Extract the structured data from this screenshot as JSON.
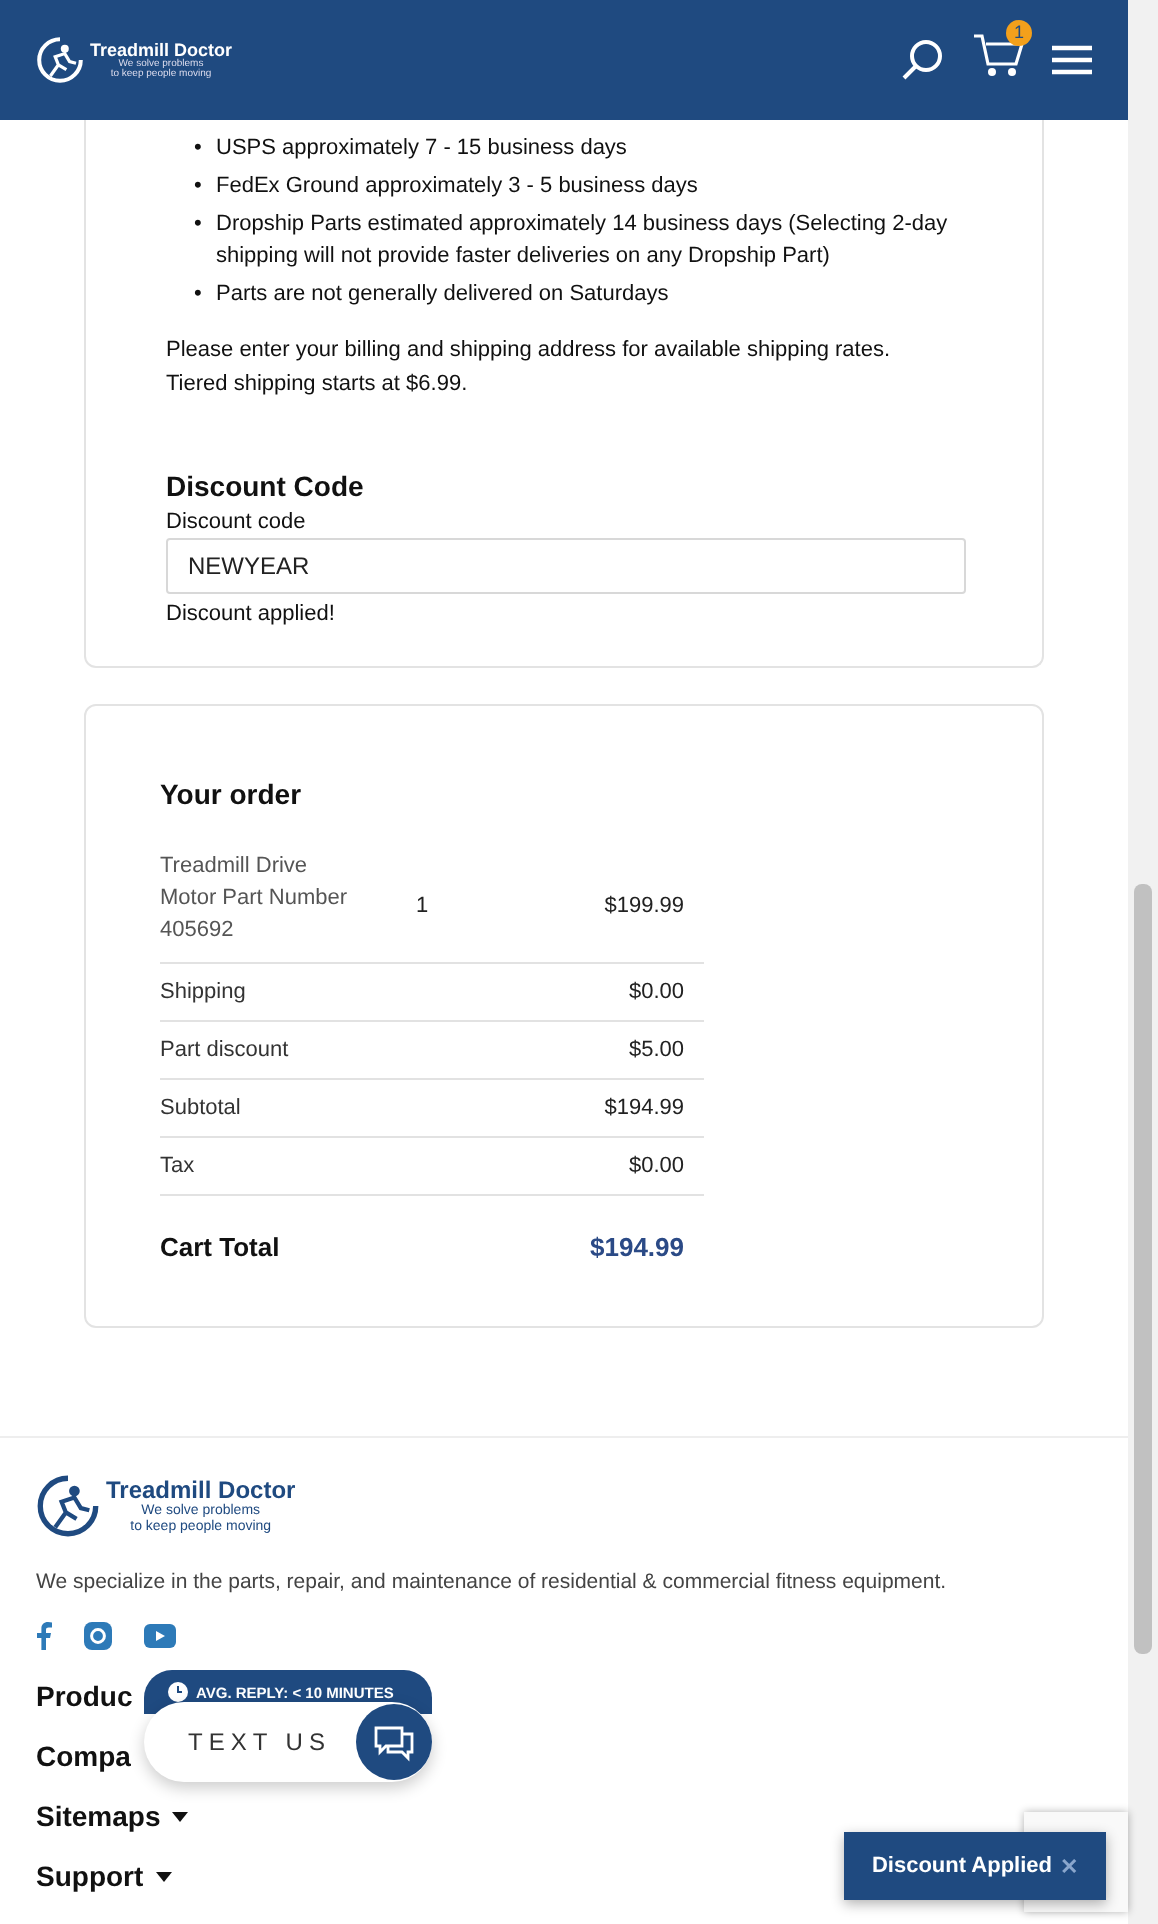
{
  "header": {
    "logo": {
      "name": "Treadmill Doctor",
      "tagline": [
        "We solve problems",
        "to keep people moving"
      ]
    },
    "cart_count": "1"
  },
  "shipping": {
    "bullets": [
      {
        "marker": "•",
        "text": "USPS approximately 7 - 15 business days"
      },
      {
        "marker": "•",
        "text": "FedEx Ground approximately 3 - 5 business days"
      },
      {
        "marker": "•",
        "text": "Dropship Parts estimated approximately 14 business days (Selecting 2-day shipping will not provide faster deliveries on any Dropship Part)"
      },
      {
        "marker": "•",
        "text": "Parts are not generally delivered on Saturdays"
      }
    ],
    "note": [
      "Please enter your billing and shipping address for available shipping rates.",
      "Tiered shipping starts at $6.99."
    ]
  },
  "discount": {
    "title": "Discount Code",
    "label": "Discount code",
    "value": "NEWYEAR",
    "message": "Discount applied!"
  },
  "order": {
    "title": "Your order",
    "item": {
      "name": "Treadmill Drive Motor Part Number 405692",
      "quantity": "1",
      "price": "$199.99"
    },
    "rows": [
      {
        "label": "Shipping",
        "value": "$0.00"
      },
      {
        "label": "Part discount",
        "value": "$5.00"
      },
      {
        "label": "Subtotal",
        "value": "$194.99"
      },
      {
        "label": "Tax",
        "value": "$0.00"
      }
    ],
    "total": {
      "label": "Cart Total",
      "value": "$194.99"
    }
  },
  "footer": {
    "logo": {
      "name": "Treadmill Doctor",
      "tagline": [
        "We solve problems",
        "to keep people moving"
      ]
    },
    "description": "We specialize in the parts, repair, and maintenance of residential & commercial fitness equipment.",
    "nav": [
      {
        "label": "Produc",
        "kind": "link"
      },
      {
        "label": "Compa",
        "kind": "link"
      },
      {
        "label": "Sitemaps",
        "kind": "dropdown"
      },
      {
        "label": "Support",
        "kind": "dropdown"
      }
    ]
  },
  "chat_widget": {
    "badge": "AVG. REPLY: < 10 MINUTES",
    "button": "TEXT US"
  },
  "toast": {
    "message": "Discount Applied",
    "close": "✕"
  }
}
